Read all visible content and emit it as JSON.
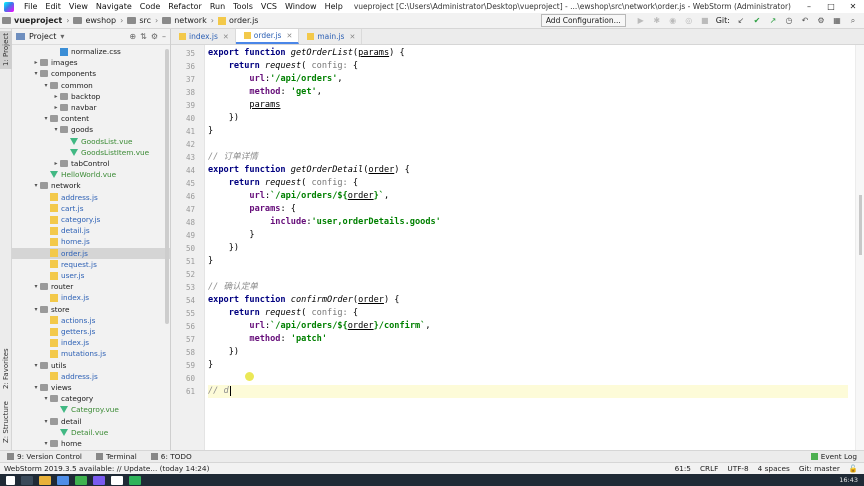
{
  "window": {
    "menu": [
      "File",
      "Edit",
      "View",
      "Navigate",
      "Code",
      "Refactor",
      "Run",
      "Tools",
      "VCS",
      "Window",
      "Help"
    ],
    "title": "vueproject [C:\\Users\\Administrator\\Desktop\\vueproject] - ...\\ewshop\\src\\network\\order.js - WebStorm (Administrator)",
    "controls": [
      "–",
      "□",
      "✕"
    ]
  },
  "breadcrumbs": [
    "vueproject",
    "ewshop",
    "src",
    "network",
    "order.js"
  ],
  "toolbar": {
    "add_config_label": "Add Configuration...",
    "git_label": "Git:"
  },
  "left_strip": {
    "project": "1: Project",
    "favorites": "2: Favorites",
    "structure": "Z: Structure"
  },
  "project_panel": {
    "title": "Project",
    "tree": [
      {
        "label": "normalize.css",
        "type": "css",
        "level": 5
      },
      {
        "label": "images",
        "type": "folder",
        "level": 3,
        "arrow": "▸"
      },
      {
        "label": "components",
        "type": "folder",
        "level": 3,
        "arrow": "▾"
      },
      {
        "label": "common",
        "type": "folder",
        "level": 4,
        "arrow": "▾"
      },
      {
        "label": "backtop",
        "type": "folder",
        "level": 5,
        "arrow": "▸"
      },
      {
        "label": "navbar",
        "type": "folder",
        "level": 5,
        "arrow": "▸"
      },
      {
        "label": "content",
        "type": "folder",
        "level": 4,
        "arrow": "▾"
      },
      {
        "label": "goods",
        "type": "folder",
        "level": 5,
        "arrow": "▾"
      },
      {
        "label": "GoodsList.vue",
        "type": "vue",
        "level": 6
      },
      {
        "label": "GoodsListItem.vue",
        "type": "vue",
        "level": 6
      },
      {
        "label": "tabControl",
        "type": "folder",
        "level": 5,
        "arrow": "▸"
      },
      {
        "label": "HelloWorld.vue",
        "type": "vue",
        "level": 4
      },
      {
        "label": "network",
        "type": "folder",
        "level": 3,
        "arrow": "▾"
      },
      {
        "label": "address.js",
        "type": "js",
        "level": 4
      },
      {
        "label": "cart.js",
        "type": "js",
        "level": 4
      },
      {
        "label": "category.js",
        "type": "js",
        "level": 4
      },
      {
        "label": "detail.js",
        "type": "js",
        "level": 4
      },
      {
        "label": "home.js",
        "type": "js",
        "level": 4
      },
      {
        "label": "order.js",
        "type": "js",
        "level": 4,
        "selected": true
      },
      {
        "label": "request.js",
        "type": "js",
        "level": 4
      },
      {
        "label": "user.js",
        "type": "js",
        "level": 4
      },
      {
        "label": "router",
        "type": "folder",
        "level": 3,
        "arrow": "▾"
      },
      {
        "label": "index.js",
        "type": "js",
        "level": 4
      },
      {
        "label": "store",
        "type": "folder",
        "level": 3,
        "arrow": "▾"
      },
      {
        "label": "actions.js",
        "type": "js",
        "level": 4
      },
      {
        "label": "getters.js",
        "type": "js",
        "level": 4
      },
      {
        "label": "index.js",
        "type": "js",
        "level": 4
      },
      {
        "label": "mutations.js",
        "type": "js",
        "level": 4
      },
      {
        "label": "utils",
        "type": "folder",
        "level": 3,
        "arrow": "▾"
      },
      {
        "label": "address.js",
        "type": "js",
        "level": 4
      },
      {
        "label": "views",
        "type": "folder",
        "level": 3,
        "arrow": "▾"
      },
      {
        "label": "category",
        "type": "folder",
        "level": 4,
        "arrow": "▾"
      },
      {
        "label": "Categroy.vue",
        "type": "vue",
        "level": 5
      },
      {
        "label": "detail",
        "type": "folder",
        "level": 4,
        "arrow": "▾"
      },
      {
        "label": "Detail.vue",
        "type": "vue",
        "level": 5
      },
      {
        "label": "home",
        "type": "folder",
        "level": 4,
        "arrow": "▾"
      }
    ]
  },
  "tabs": [
    {
      "label": "index.js",
      "active": false
    },
    {
      "label": "order.js",
      "active": true
    },
    {
      "label": "main.js",
      "active": false
    }
  ],
  "code_lines": [
    {
      "n": "35",
      "t": [
        [
          "kw",
          "export function "
        ],
        [
          "fn",
          "getOrderList"
        ],
        [
          "",
          "("
        ],
        [
          "ul",
          "params"
        ],
        [
          "",
          ") {"
        ]
      ]
    },
    {
      "n": "36",
      "t": [
        [
          "",
          "    "
        ],
        [
          "kw",
          "return "
        ],
        [
          "fn",
          "request"
        ],
        [
          "",
          "( "
        ],
        [
          "hint",
          "config: "
        ],
        [
          "",
          "{"
        ]
      ]
    },
    {
      "n": "37",
      "t": [
        [
          "",
          "        "
        ],
        [
          "prop",
          "url"
        ],
        [
          "",
          ":"
        ],
        [
          "str",
          "'/api/orders'"
        ],
        [
          "",
          ","
        ]
      ]
    },
    {
      "n": "38",
      "t": [
        [
          "",
          "        "
        ],
        [
          "prop",
          "method"
        ],
        [
          "",
          ": "
        ],
        [
          "str",
          "'get'"
        ],
        [
          "",
          ","
        ]
      ]
    },
    {
      "n": "39",
      "t": [
        [
          "",
          "        "
        ],
        [
          "ul",
          "params"
        ]
      ]
    },
    {
      "n": "40",
      "t": [
        [
          "",
          "    })"
        ]
      ]
    },
    {
      "n": "41",
      "t": [
        [
          "",
          "}"
        ]
      ]
    },
    {
      "n": "42",
      "t": []
    },
    {
      "n": "43",
      "t": [
        [
          "cmt",
          "// 订单详情"
        ]
      ]
    },
    {
      "n": "44",
      "t": [
        [
          "kw",
          "export function "
        ],
        [
          "fn",
          "getOrderDetail"
        ],
        [
          "",
          "("
        ],
        [
          "ul",
          "order"
        ],
        [
          "",
          ") {"
        ]
      ]
    },
    {
      "n": "45",
      "t": [
        [
          "",
          "    "
        ],
        [
          "kw",
          "return "
        ],
        [
          "fn",
          "request"
        ],
        [
          "",
          "( "
        ],
        [
          "hint",
          "config: "
        ],
        [
          "",
          "{"
        ]
      ]
    },
    {
      "n": "46",
      "t": [
        [
          "",
          "        "
        ],
        [
          "prop",
          "url"
        ],
        [
          "",
          ":"
        ],
        [
          "str",
          "`/api/orders/${"
        ],
        [
          "ul",
          "order"
        ],
        [
          "str",
          "}`"
        ],
        [
          "",
          ","
        ]
      ]
    },
    {
      "n": "47",
      "t": [
        [
          "",
          "        "
        ],
        [
          "prop",
          "params"
        ],
        [
          "",
          ": {"
        ]
      ]
    },
    {
      "n": "48",
      "t": [
        [
          "",
          "            "
        ],
        [
          "prop",
          "include"
        ],
        [
          "",
          ":"
        ],
        [
          "str",
          "'user,orderDetails.goods'"
        ]
      ]
    },
    {
      "n": "49",
      "t": [
        [
          "",
          "        }"
        ]
      ]
    },
    {
      "n": "50",
      "t": [
        [
          "",
          "    })"
        ]
      ]
    },
    {
      "n": "51",
      "t": [
        [
          "",
          "}"
        ]
      ]
    },
    {
      "n": "52",
      "t": []
    },
    {
      "n": "53",
      "t": [
        [
          "cmt",
          "// 确认定单"
        ]
      ]
    },
    {
      "n": "54",
      "t": [
        [
          "kw",
          "export function "
        ],
        [
          "fn",
          "confirmOrder"
        ],
        [
          "",
          "("
        ],
        [
          "ul",
          "order"
        ],
        [
          "",
          ") {"
        ]
      ]
    },
    {
      "n": "55",
      "t": [
        [
          "",
          "    "
        ],
        [
          "kw",
          "return "
        ],
        [
          "fn",
          "request"
        ],
        [
          "",
          "( "
        ],
        [
          "hint",
          "config: "
        ],
        [
          "",
          "{"
        ]
      ]
    },
    {
      "n": "56",
      "t": [
        [
          "",
          "        "
        ],
        [
          "prop",
          "url"
        ],
        [
          "",
          ":"
        ],
        [
          "str",
          "`/api/orders/${"
        ],
        [
          "ul",
          "order"
        ],
        [
          "str",
          "}/confirm`"
        ],
        [
          "",
          ","
        ]
      ]
    },
    {
      "n": "57",
      "t": [
        [
          "",
          "        "
        ],
        [
          "prop",
          "method"
        ],
        [
          "",
          ": "
        ],
        [
          "str",
          "'patch'"
        ]
      ]
    },
    {
      "n": "58",
      "t": [
        [
          "",
          "    })"
        ]
      ]
    },
    {
      "n": "59",
      "t": [
        [
          "",
          "}"
        ]
      ]
    },
    {
      "n": "60",
      "t": []
    },
    {
      "n": "61",
      "t": [
        [
          "cmt",
          "// d"
        ]
      ],
      "current": true
    }
  ],
  "bottom_tools": {
    "vcs": "9: Version Control",
    "terminal": "Terminal",
    "todo": "6: TODO",
    "event_log": "Event Log"
  },
  "status": {
    "message": "WebStorm 2019.3.5 available: // Update... (today 14:24)",
    "position": "61:5",
    "line_sep": "CRLF",
    "encoding": "UTF-8",
    "indent": "4 spaces",
    "branch": "Git: master"
  },
  "taskbar": {
    "clock": "16:43"
  }
}
